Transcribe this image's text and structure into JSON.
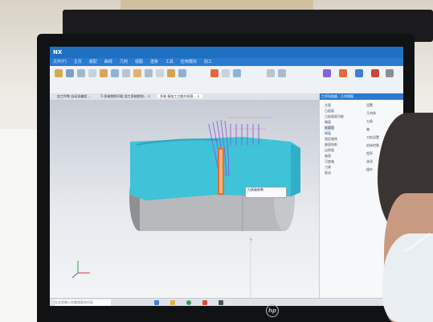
{
  "app": {
    "logo": "NX",
    "menus": [
      "文件(F)",
      "主页",
      "装配",
      "曲线",
      "几何",
      "视图",
      "渲染",
      "工具",
      "应用模块",
      "加工"
    ],
    "doc_tabs": [
      "加工件数 自动化编程 ...",
      "5-多轴铣削开粗 加工多轴铣削... ×",
      "多轴 精加工刀路外轮廓... ×"
    ]
  },
  "nav_panel": {
    "title": "工序导航器 - 几何视图",
    "items": [
      "主面",
      "凸起面",
      "凸起曲面功能",
      "端面",
      "轮廓面",
      "侧面",
      "固定轴铣",
      "曲面铣削",
      "边界面",
      "轴面",
      "可变轴",
      "刀具",
      "驱动"
    ]
  },
  "right_column": {
    "items": [
      "设置",
      "几何体",
      "刀具",
      "轴",
      "刀轨设置",
      "机床控制",
      "程序",
      "选项",
      "操作"
    ]
  },
  "dialog": {
    "label": "刀具轴参数"
  },
  "taskbar": {
    "search_placeholder": "在这里输入你要搜索的内容"
  },
  "brand": {
    "monitor_logo": "hp"
  },
  "colors": {
    "part": "#3ec3d8",
    "cylinder": "#b8b9bd",
    "toolpath": "#8a4fd6",
    "tool": "#e07030",
    "titlebar": "#1e6fbf"
  }
}
